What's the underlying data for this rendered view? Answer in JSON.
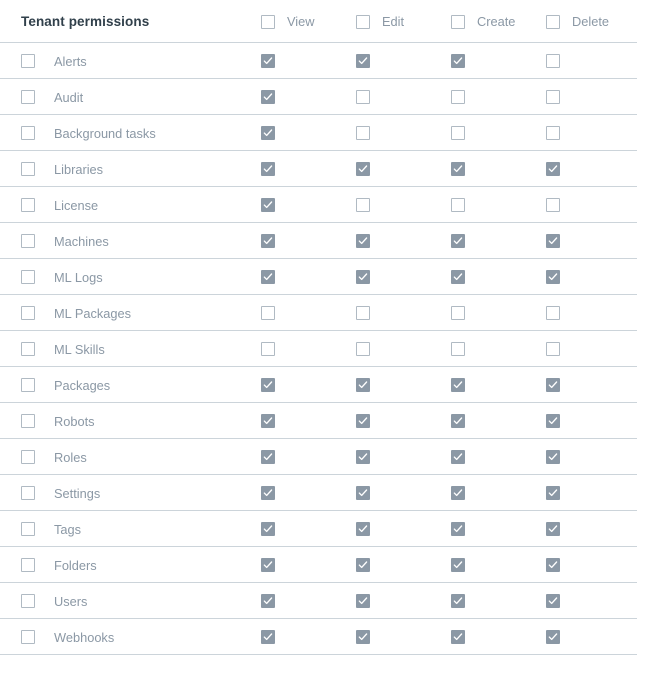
{
  "header": {
    "title": "Tenant permissions",
    "columns": [
      {
        "label": "View"
      },
      {
        "label": "Edit"
      },
      {
        "label": "Create"
      },
      {
        "label": "Delete"
      }
    ]
  },
  "colors": {
    "checked_fill": "#8b98a5",
    "checkbox_border": "#b0bac3",
    "divider": "#ccd4da",
    "title_text": "#31404b",
    "label_text": "#8b98a5"
  },
  "rows": [
    {
      "label": "Alerts",
      "selected": false,
      "view": true,
      "edit": true,
      "create": true,
      "delete": false
    },
    {
      "label": "Audit",
      "selected": false,
      "view": true,
      "edit": false,
      "create": false,
      "delete": false
    },
    {
      "label": "Background tasks",
      "selected": false,
      "view": true,
      "edit": false,
      "create": false,
      "delete": false
    },
    {
      "label": "Libraries",
      "selected": false,
      "view": true,
      "edit": true,
      "create": true,
      "delete": true
    },
    {
      "label": "License",
      "selected": false,
      "view": true,
      "edit": false,
      "create": false,
      "delete": false
    },
    {
      "label": "Machines",
      "selected": false,
      "view": true,
      "edit": true,
      "create": true,
      "delete": true
    },
    {
      "label": "ML Logs",
      "selected": false,
      "view": true,
      "edit": true,
      "create": true,
      "delete": true
    },
    {
      "label": "ML Packages",
      "selected": false,
      "view": false,
      "edit": false,
      "create": false,
      "delete": false
    },
    {
      "label": "ML Skills",
      "selected": false,
      "view": false,
      "edit": false,
      "create": false,
      "delete": false
    },
    {
      "label": "Packages",
      "selected": false,
      "view": true,
      "edit": true,
      "create": true,
      "delete": true
    },
    {
      "label": "Robots",
      "selected": false,
      "view": true,
      "edit": true,
      "create": true,
      "delete": true
    },
    {
      "label": "Roles",
      "selected": false,
      "view": true,
      "edit": true,
      "create": true,
      "delete": true
    },
    {
      "label": "Settings",
      "selected": false,
      "view": true,
      "edit": true,
      "create": true,
      "delete": true
    },
    {
      "label": "Tags",
      "selected": false,
      "view": true,
      "edit": true,
      "create": true,
      "delete": true
    },
    {
      "label": "Folders",
      "selected": false,
      "view": true,
      "edit": true,
      "create": true,
      "delete": true
    },
    {
      "label": "Users",
      "selected": false,
      "view": true,
      "edit": true,
      "create": true,
      "delete": true
    },
    {
      "label": "Webhooks",
      "selected": false,
      "view": true,
      "edit": true,
      "create": true,
      "delete": true
    }
  ]
}
